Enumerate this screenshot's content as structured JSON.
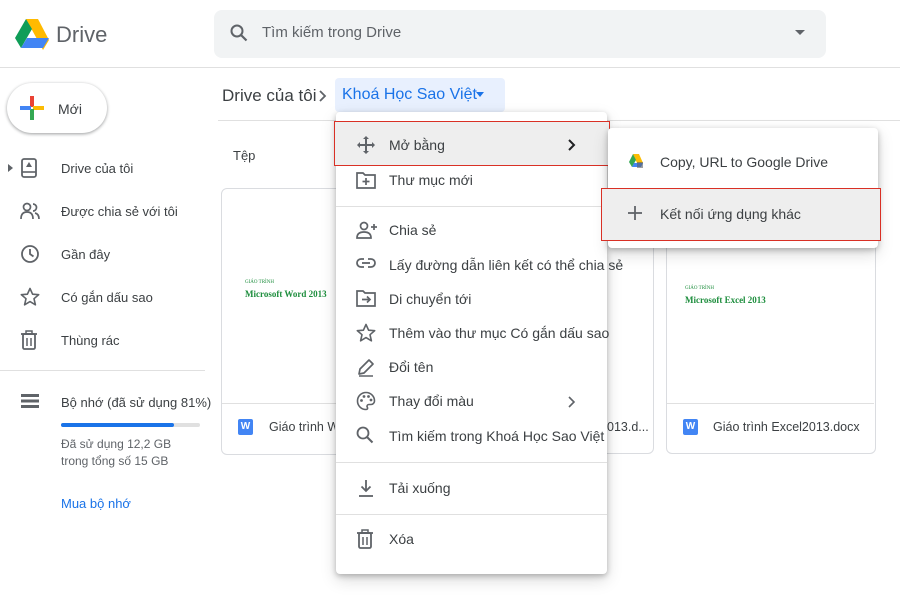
{
  "app": {
    "brand": "Drive"
  },
  "search": {
    "placeholder": "Tìm kiếm trong Drive"
  },
  "new_button": {
    "label": "Mới"
  },
  "sidebar": {
    "items": [
      {
        "label": "Drive của tôi",
        "icon": "my-drive-icon"
      },
      {
        "label": "Được chia sẻ với tôi",
        "icon": "shared-users-icon"
      },
      {
        "label": "Gần đây",
        "icon": "clock-icon"
      },
      {
        "label": "Có gắn dấu sao",
        "icon": "star-icon"
      },
      {
        "label": "Thùng rác",
        "icon": "trash-icon"
      }
    ],
    "storage": {
      "label": "Bộ nhớ (đã sử dụng 81%)",
      "used_fraction": 0.81,
      "detail": "Đã sử dụng 12,2 GB trong tổng số 15 GB",
      "buy_label": "Mua bộ nhớ"
    }
  },
  "breadcrumb": {
    "root": "Drive của tôi",
    "current": "Khoá Học Sao Việt"
  },
  "files_section": {
    "heading": "Tệp",
    "cards": [
      {
        "thumb_sub": "GIÁO TRÌNH",
        "thumb_title": "Microsoft Word 2013",
        "name": "Giáo trình Word2013.docx",
        "visible_name": "Giáo trình Wo",
        "type_icon": "W"
      },
      {
        "name_suffix": "013.d..."
      },
      {
        "thumb_sub": "GIÁO TRÌNH",
        "thumb_title": "Microsoft Excel 2013",
        "name": "Giáo trình Excel2013.docx",
        "type_icon": "W"
      }
    ]
  },
  "context_menu": {
    "items": [
      {
        "label": "Mở bằng",
        "icon": "open-with-icon",
        "has_submenu": true
      },
      {
        "label": "Thư mục mới",
        "icon": "new-folder-icon"
      },
      {
        "label": "Chia sẻ",
        "icon": "share-person-icon"
      },
      {
        "label": "Lấy đường dẫn liên kết có thể chia sẻ",
        "icon": "link-icon"
      },
      {
        "label": "Di chuyển tới",
        "icon": "move-to-icon"
      },
      {
        "label": "Thêm vào thư mục Có gắn dấu sao",
        "icon": "star-icon"
      },
      {
        "label": "Đổi tên",
        "icon": "rename-pencil-icon"
      },
      {
        "label": "Thay đổi màu",
        "icon": "palette-icon",
        "has_submenu": true
      },
      {
        "label": "Tìm kiếm trong Khoá Học Sao Việt",
        "icon": "search-icon"
      },
      {
        "label": "Tải xuống",
        "icon": "download-icon"
      },
      {
        "label": "Xóa",
        "icon": "trash-icon"
      }
    ]
  },
  "submenu": {
    "items": [
      {
        "label": "Copy, URL to Google Drive",
        "icon": "app-icon"
      },
      {
        "label": "Kết nối ứng dụng khác",
        "icon": "plus-icon"
      }
    ]
  },
  "colors": {
    "accent": "#1a73e8",
    "highlight_border": "#d93025"
  }
}
